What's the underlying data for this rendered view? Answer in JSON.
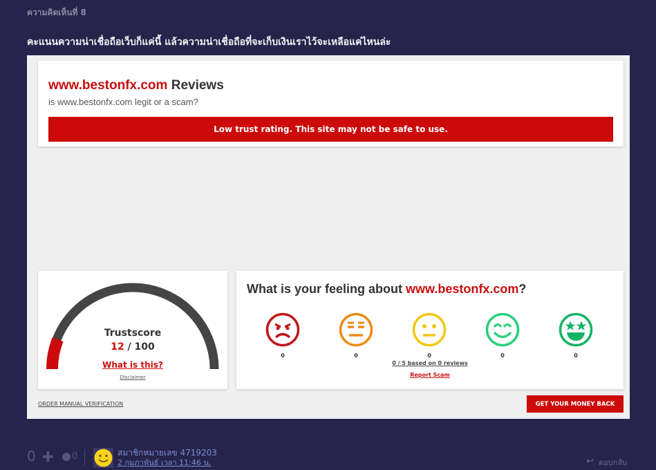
{
  "comment": {
    "number_label": "ความคิดเห็นที่ 8",
    "text": "คะแนนความน่าเชื่อถือเว็บก็แค่นี้ แล้วความน่าเชื่อถือที่จะเก็บเงินเราไว้จะเหลือแค่ไหนล่ะ"
  },
  "review": {
    "site": "www.bestonfx.com",
    "title_suffix": " Reviews",
    "subtitle": "is www.bestonfx.com legit or a scam?",
    "warning": "Low trust rating. This site may not be safe to use.",
    "trust_label": "Trustscore",
    "trust_value": "12",
    "trust_max": " / 100",
    "trust_score_fraction": 0.12,
    "what_is_this": "What is this?",
    "disclaimer": "Disclaimer",
    "feeling_prefix": "What is your feeling about ",
    "feeling_suffix": "?",
    "emojis": [
      {
        "name": "angry-face-icon",
        "color": "#c0161c",
        "count": "0"
      },
      {
        "name": "annoyed-face-icon",
        "color": "#ef8b16",
        "count": "0"
      },
      {
        "name": "neutral-face-icon",
        "color": "#f0c712",
        "count": "0"
      },
      {
        "name": "smiling-face-icon",
        "color": "#2ad07a",
        "count": "0"
      },
      {
        "name": "star-eyes-face-icon",
        "color": "#17b367",
        "count": "0"
      }
    ],
    "based_on": "0 / 5 based on 0 reviews",
    "report_scam": "Report Scam",
    "order_manual": "ORDER MANUAL VERIFICATION",
    "money_back": "GET YOUR MONEY BACK",
    "colors": {
      "brand_red": "#cd0a0a",
      "gauge_track": "#454545"
    }
  },
  "footer": {
    "votes": "0",
    "plus": "✚",
    "reactions": "0",
    "member": "สมาชิกหมายเลข 4719203",
    "date": "2 กุมภาพันธ์ เวลา 11:46 น.",
    "reply": "ตอบกลับ"
  }
}
